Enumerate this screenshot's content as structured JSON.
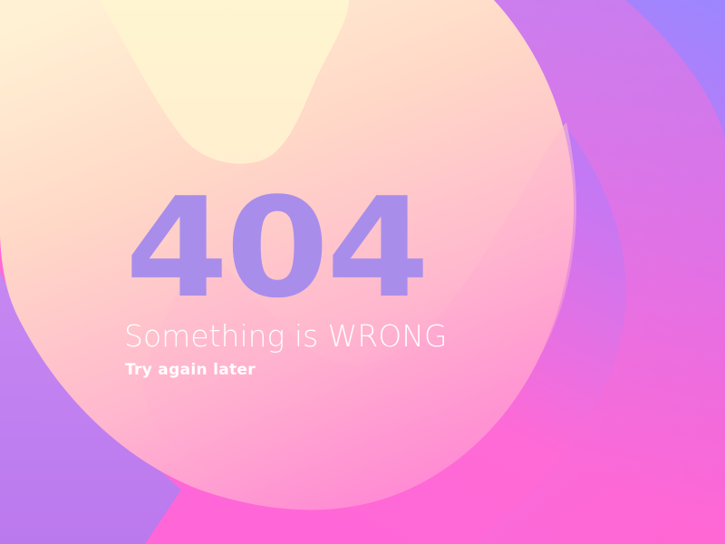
{
  "error_page": {
    "code": "404",
    "headline": "Something is WRONG",
    "subline": "Try again later"
  },
  "colors": {
    "code_text": "#A98DEB",
    "message_text": "#FFFFFF",
    "blob_light": "#FFF4D2",
    "blob_peach": "#FFD9C6",
    "background_purple": "#A683FF",
    "background_pink": "#FF66D4"
  }
}
